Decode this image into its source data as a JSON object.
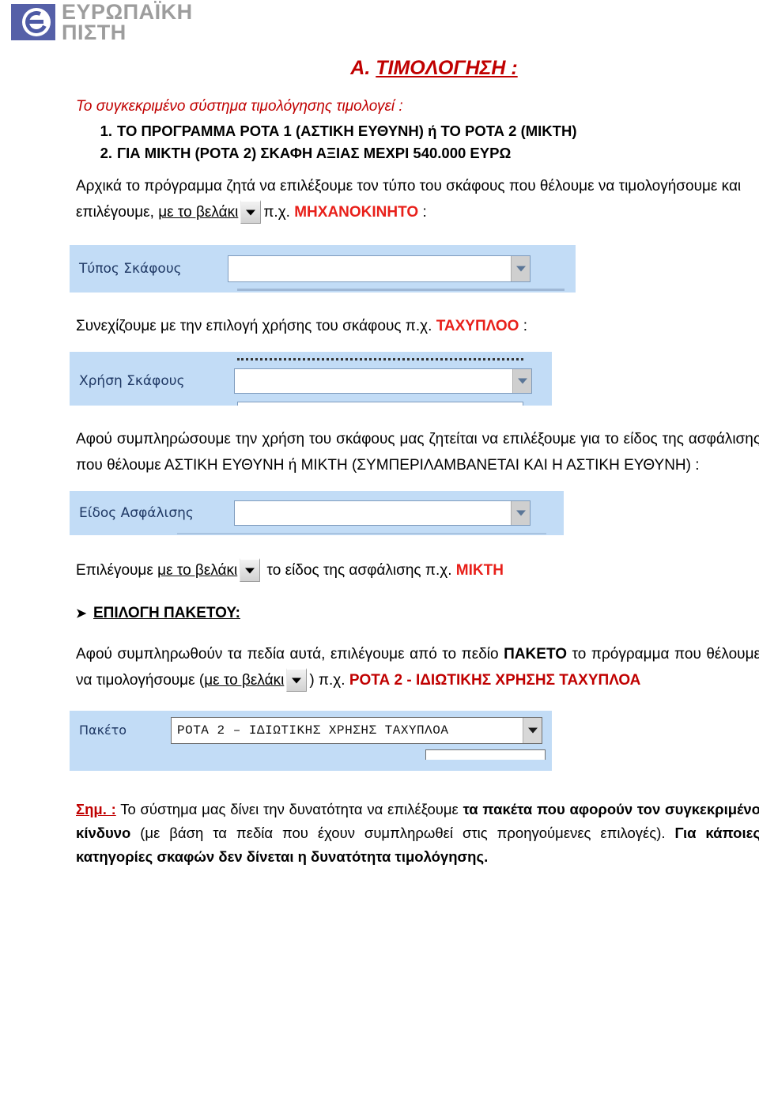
{
  "header": {
    "logo_line1": "ΕΥΡΩΠΑΪΚΗ",
    "logo_line2": "ΠΙΣΤΗ",
    "logo_icon": "europaiki-pisti-emblem"
  },
  "document": {
    "title_prefix": "Α. ",
    "title_main": "ΤΙΜΟΛΟΓΗΣΗ :",
    "lead": "Το συγκεκριμένο σύστημα τιμολόγησης τιμολογεί :",
    "numbered_items": [
      "ΤΟ ΠΡΟΓΡΑΜΜΑ ΡΟΤΑ 1 (ΑΣΤΙΚΗ ΕΥΘΥΝΗ) ή ΤΟ ΡΟΤΑ 2 (ΜΙΚΤΗ)",
      "ΓΙΑ ΜΙΚΤΗ (ΡΟΤΑ 2) ΣΚΑΦΗ ΑΞΙΑΣ ΜΕΧΡΙ  540.000 ΕΥΡΩ"
    ],
    "para1_a": "Αρχικά το πρόγραμμα ζητά να επιλέξουμε τον τύπο του σκάφους που θέλουμε να τιμολογήσουμε και  επιλέγουμε, ",
    "para1_link": "με το βελάκι",
    "para1_b": "π.χ. ",
    "para1_red": "ΜΗΧΑΝΟΚΙΝΗΤΟ",
    "para1_c": " :",
    "para2_a": "Συνεχίζουμε με την επιλογή χρήσης του σκάφους π.χ. ",
    "para2_red": "ΤΑΧΥΠΛΟΟ",
    "para2_b": "  :",
    "para3": "Αφού συμπληρώσουμε την χρήση του σκάφους μας ζητείται να  επιλέξουμε για το είδος της ασφάλισης που θέλουμε    ΑΣΤΙΚΗ   ΕΥΘΥΝΗ   ή   ΜΙΚΤΗ (ΣΥΜΠΕΡΙΛΑΜΒΑΝΕΤΑΙ ΚΑΙ Η ΑΣΤΙΚΗ ΕΥΘΥΝΗ) :",
    "para4_a": "Επιλέγουμε  ",
    "para4_link": "με το βελάκι",
    "para4_b": " το είδος της ασφάλισης π.χ. ",
    "para4_red": "ΜΙΚΤΗ",
    "section_heading": "ΕΠΙΛΟΓΗ ΠΑΚΕΤΟΥ:",
    "para5_a": "Αφού συμπληρωθούν τα πεδία αυτά, επιλέγουμε από το πεδίο ",
    "para5_bold": "ΠΑΚΕΤΟ",
    "para5_b": " το πρόγραμμα που θέλουμε να τιμολογήσουμε (",
    "para5_link": "με το βελάκι",
    "para5_c": ")  π.χ. ",
    "para5_red": "ΡΟΤΑ 2 - ΙΔΙΩΤΙΚΗΣ ΧΡΗΣΗΣ ΤΑΧΥΠΛΟΑ",
    "note_label": "Σημ. :",
    "note_a": " Το σύστημα μας δίνει την δυνατότητα να επιλέξουμε ",
    "note_bold1": "τα πακέτα που αφορούν τον συγκεκριμένο κίνδυνο",
    "note_b": " (με βάση τα πεδία που έχουν συμπληρωθεί στις  προηγούμενες επιλογές). ",
    "note_bold2": "Για κάποιες κατηγορίες σκαφών δεν δίνεται η δυνατότητα τιμολόγησης."
  },
  "screenshots": [
    {
      "id": "tipos-skafous",
      "label": "Τύπος Σκάφους",
      "value": "",
      "dropdown_icon": "chevron-down-icon"
    },
    {
      "id": "xrisi-skafous",
      "label": "Χρήση Σκάφους",
      "value": "",
      "dropdown_icon": "chevron-down-icon"
    },
    {
      "id": "eidos-asfalisis",
      "label": "Είδος Ασφάλισης",
      "value": "",
      "dropdown_icon": "chevron-down-icon"
    },
    {
      "id": "paketo",
      "label": "Πακέτο",
      "value": "ΡΟΤΑ 2 – ΙΔΙΩΤΙΚΗΣ ΧΡΗΣΗΣ ΤΑΧΥΠΛΟΑ",
      "dropdown_icon": "chevron-down-icon"
    }
  ],
  "colors": {
    "title_red": "#c00000",
    "accent_red": "#e8201a",
    "field_blue": "#c2dcf6",
    "field_label": "#1f3864",
    "logo_blue": "#5560a8",
    "logo_grey": "#9d9d9d"
  }
}
